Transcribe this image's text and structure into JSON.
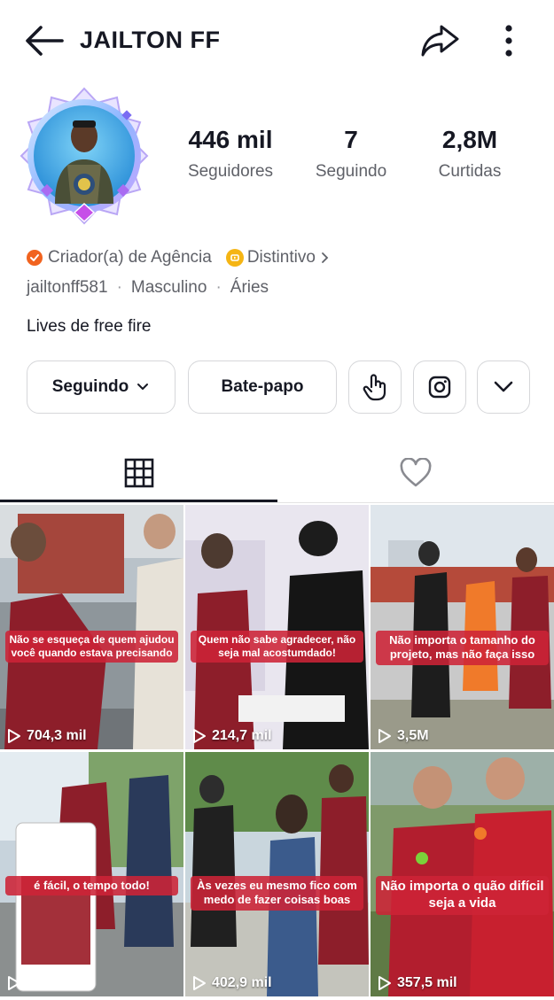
{
  "header": {
    "title": "JAILTON FF"
  },
  "stats": [
    {
      "value": "446 mil",
      "label": "Seguidores"
    },
    {
      "value": "7",
      "label": "Seguindo"
    },
    {
      "value": "2,8M",
      "label": "Curtidas"
    }
  ],
  "profile": {
    "creator_label": "Criador(a) de Agência",
    "badge_label": "Distintivo",
    "username": "jailtonff581",
    "gender": "Masculino",
    "sign": "Áries",
    "bio": "Lives de free fire"
  },
  "actions": {
    "following_label": "Seguindo",
    "chat_label": "Bate-papo"
  },
  "videos": [
    {
      "caption": "Não se esqueça de quem ajudou você quando estava precisando",
      "views": "704,3 mil"
    },
    {
      "caption": "Quem não sabe agradecer, não seja mal acostumdado!",
      "views": "214,7 mil"
    },
    {
      "caption": "Não importa o tamanho do projeto, mas  não faça isso",
      "views": "3,5M"
    },
    {
      "caption": "é fácil, o tempo todo!",
      "views": ""
    },
    {
      "caption": "Às vezes eu mesmo fico com medo de fazer coisas boas",
      "views": "402,9 mil"
    },
    {
      "caption": "Não importa o quão difícil seja a vida",
      "views": "357,5 mil"
    }
  ],
  "icons": {
    "back": "arrow-left-icon",
    "share": "share-arrow-icon",
    "more": "more-vertical-icon",
    "grid": "grid-icon",
    "liked": "heart-icon",
    "tap": "tap-hand-icon",
    "instagram": "instagram-icon",
    "chevron": "chevron-down-icon",
    "play": "play-icon"
  },
  "colors": {
    "accent_verified": "#f1631f",
    "badge": "#f5b514",
    "caption_bg": "#cd2337"
  }
}
